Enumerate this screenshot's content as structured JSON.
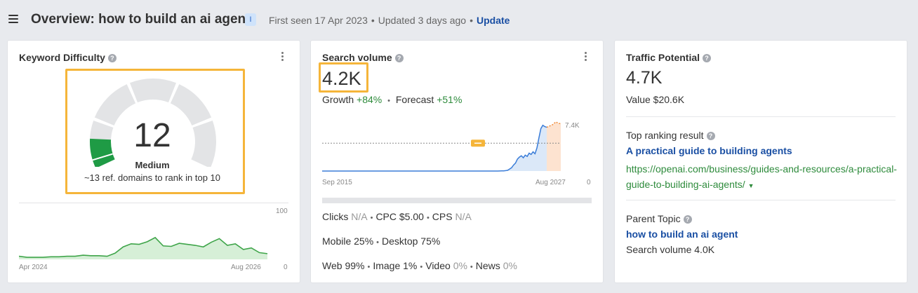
{
  "header": {
    "title": "Overview: how to build an ai agent",
    "badge": "I",
    "first_seen": "First seen 17 Apr 2023",
    "updated": "Updated 3 days ago",
    "update_link": "Update"
  },
  "keyword_difficulty": {
    "title": "Keyword Difficulty",
    "score": "12",
    "score_value": 12,
    "level": "Medium",
    "description": "~13 ref. domains to rank in top 10",
    "gauge_colors": {
      "filled": "#1f9b45",
      "empty": "#e3e4e6"
    },
    "mini_chart": {
      "x_start": "Apr 2024",
      "x_end": "Aug 2026",
      "y_max": "100",
      "y_min": "0",
      "values": [
        6,
        4,
        4,
        4,
        5,
        5,
        6,
        6,
        8,
        7,
        7,
        6,
        12,
        24,
        30,
        29,
        34,
        42,
        26,
        25,
        31,
        29,
        27,
        24,
        33,
        40,
        27,
        30,
        19,
        22,
        13,
        11
      ],
      "color": "#3fa54a"
    }
  },
  "search_volume": {
    "title": "Search volume",
    "value": "4.2K",
    "growth_label": "Growth",
    "growth_value": "+84%",
    "forecast_label": "Forecast",
    "forecast_value": "+51%",
    "chart_data": {
      "type": "line",
      "x_start": "Sep 2015",
      "x_end": "Aug 2027",
      "y_max_label": "7.4K",
      "y_min_label": "0",
      "ylim": [
        0,
        7400
      ],
      "reference_level": 4200,
      "history": [
        0,
        0,
        0,
        0,
        0,
        0,
        0,
        0,
        0,
        0,
        0,
        0,
        0,
        0,
        0,
        0,
        0,
        0,
        0,
        0,
        0,
        0,
        0,
        0,
        0,
        0,
        0,
        0,
        0,
        0,
        0,
        0,
        0,
        0,
        0,
        0,
        0,
        0,
        0,
        0,
        0,
        0,
        0,
        0,
        0,
        0,
        0,
        0,
        0,
        0,
        0,
        0,
        0,
        0,
        0,
        0,
        0,
        0,
        0,
        0,
        0,
        0,
        0,
        0,
        0,
        0,
        0,
        0,
        0,
        0,
        0,
        0,
        0,
        0,
        0,
        0,
        0,
        0,
        0,
        0,
        0,
        0,
        0,
        0,
        0,
        0,
        0,
        0,
        0,
        0,
        0,
        10,
        20,
        30,
        60,
        120,
        300,
        500,
        900,
        1200,
        1800,
        2100,
        2300,
        2000,
        2400,
        2200,
        2700,
        2500,
        2900,
        2600,
        3500,
        5000,
        6400,
        6900,
        6700,
        6600
      ],
      "forecast": [
        6600,
        6800,
        7000,
        7400,
        7200,
        7100,
        7300,
        7100,
        6900
      ],
      "history_color": "#3b7dd8",
      "forecast_color": "#f08c3a"
    },
    "metrics_row1": [
      {
        "label": "Clicks",
        "value": "N/A"
      },
      {
        "label": "CPC",
        "value": "$5.00"
      },
      {
        "label": "CPS",
        "value": "N/A"
      }
    ],
    "metrics_row2": [
      {
        "label": "Mobile",
        "value": "25%"
      },
      {
        "label": "Desktop",
        "value": "75%"
      }
    ],
    "metrics_row3": [
      {
        "label": "Web",
        "value": "99%"
      },
      {
        "label": "Image",
        "value": "1%"
      },
      {
        "label": "Video",
        "value": "0%"
      },
      {
        "label": "News",
        "value": "0%"
      }
    ]
  },
  "traffic_potential": {
    "title": "Traffic Potential",
    "value": "4.7K",
    "value_line": "Value $20.6K",
    "top_ranking_label": "Top ranking result",
    "top_ranking_title": "A practical guide to building agents",
    "top_ranking_url": "https://openai.com/business/guides-and-resources/a-practical-guide-to-building-ai-agents/",
    "parent_topic_label": "Parent Topic",
    "parent_topic_link": "how to build an ai agent",
    "parent_topic_volume": "Search volume 4.0K"
  }
}
